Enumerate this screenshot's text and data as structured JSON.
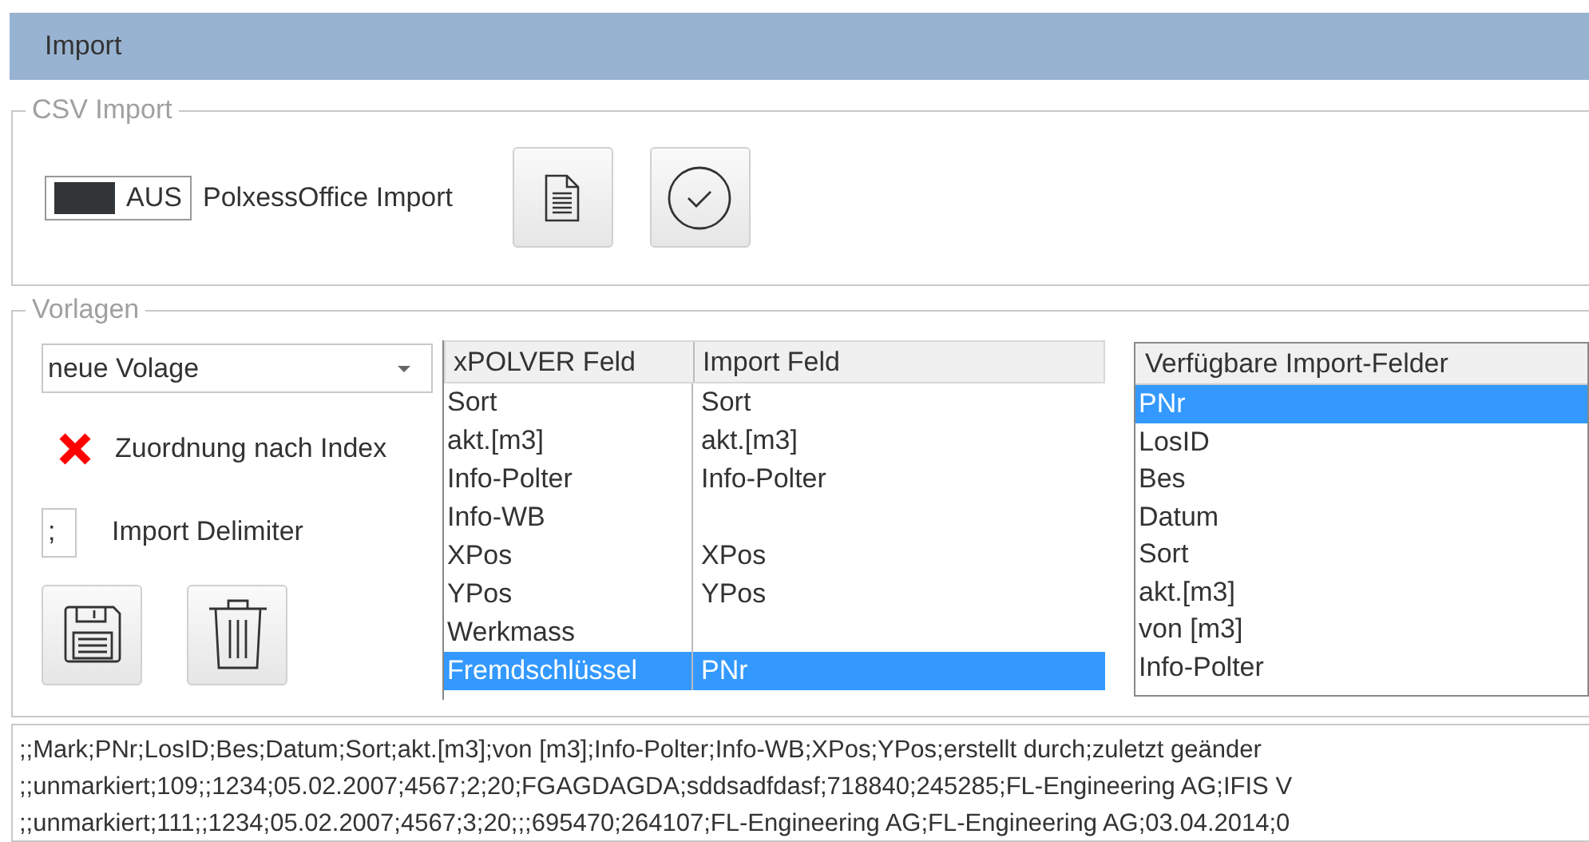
{
  "window": {
    "title": "Import"
  },
  "csv_import": {
    "title": "CSV Import",
    "toggle": {
      "label": "AUS",
      "on": false
    },
    "toggle_caption": "PolxessOffice Import"
  },
  "vorlagen": {
    "title": "Vorlagen",
    "template_select": {
      "value": "neue Volage"
    },
    "index_mapping": {
      "label": "Zuordnung nach Index",
      "checked": false
    },
    "delimiter": {
      "value": ";",
      "label": "Import Delimiter"
    },
    "mapping_table": {
      "columns": [
        "xPOLVER Feld",
        "Import Feld"
      ],
      "rows": [
        {
          "xpolver": "Sort",
          "import": "Sort",
          "selected": false
        },
        {
          "xpolver": "akt.[m3]",
          "import": "akt.[m3]",
          "selected": false
        },
        {
          "xpolver": "Info-Polter",
          "import": "Info-Polter",
          "selected": false
        },
        {
          "xpolver": "Info-WB",
          "selected": false
        },
        {
          "xpolver": "XPos",
          "import": "XPos",
          "selected": false
        },
        {
          "xpolver": "YPos",
          "import": "YPos",
          "selected": false
        },
        {
          "xpolver": "Werkmass",
          "selected": false
        },
        {
          "xpolver": "Fremdschlüssel",
          "import": "PNr",
          "selected": true
        }
      ]
    },
    "available_fields": {
      "title": "Verfügbare Import-Felder",
      "items": [
        {
          "label": "PNr",
          "selected": true
        },
        {
          "label": "LosID",
          "selected": false
        },
        {
          "label": "Bes",
          "selected": false
        },
        {
          "label": "Datum",
          "selected": false
        },
        {
          "label": "Sort",
          "selected": false
        },
        {
          "label": "akt.[m3]",
          "selected": false
        },
        {
          "label": "von [m3]",
          "selected": false
        },
        {
          "label": "Info-Polter",
          "selected": false
        }
      ]
    }
  },
  "preview_lines": [
    ";;Mark;PNr;LosID;Bes;Datum;Sort;akt.[m3];von [m3];Info-Polter;Info-WB;XPos;YPos;erstellt durch;zuletzt geänder",
    ";;unmarkiert;109;;1234;05.02.2007;4567;2;20;FGAGDAGDA;sddsadfdasf;718840;245285;FL-Engineering AG;IFIS V",
    ";;unmarkiert;111;;1234;05.02.2007;4567;3;20;;;695470;264107;FL-Engineering AG;FL-Engineering AG;03.04.2014;0"
  ]
}
